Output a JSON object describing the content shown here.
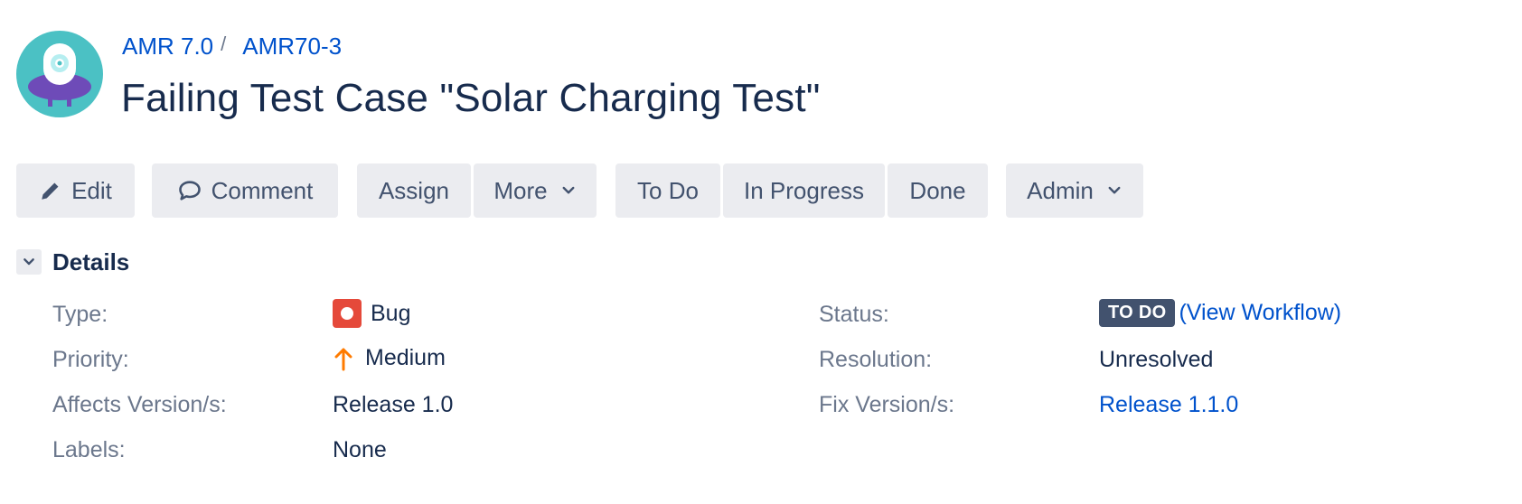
{
  "breadcrumb": {
    "project": "AMR 7.0",
    "separator": "/",
    "issue_key": "AMR70-3"
  },
  "issue": {
    "title": "Failing Test Case \"Solar Charging Test\""
  },
  "toolbar": {
    "edit": "Edit",
    "comment": "Comment",
    "assign": "Assign",
    "more": "More",
    "todo": "To Do",
    "in_progress": "In Progress",
    "done": "Done",
    "admin": "Admin"
  },
  "details": {
    "heading": "Details",
    "type_label": "Type:",
    "type_value": "Bug",
    "priority_label": "Priority:",
    "priority_value": "Medium",
    "affects_label": "Affects Version/s:",
    "affects_value": "Release 1.0",
    "labels_label": "Labels:",
    "labels_value": "None",
    "status_label": "Status:",
    "status_badge": "TO DO",
    "view_workflow": "(View Workflow)",
    "resolution_label": "Resolution:",
    "resolution_value": "Unresolved",
    "fix_label": "Fix Version/s:",
    "fix_value": "Release 1.1.0"
  },
  "colors": {
    "link": "#0052cc",
    "button_bg": "#ebecf0",
    "status_badge_bg": "#42526e",
    "bug_red": "#e5493a",
    "priority_orange": "#ff7b00",
    "avatar_teal": "#4bc1c4",
    "avatar_purple": "#6e4bb8"
  },
  "icons": {
    "avatar": "project-avatar-robot",
    "edit": "pencil-icon",
    "comment": "speech-bubble-icon",
    "dropdown": "chevron-down-icon",
    "details_toggle": "chevron-down-icon",
    "type": "bug-icon",
    "priority": "arrow-up-icon"
  }
}
